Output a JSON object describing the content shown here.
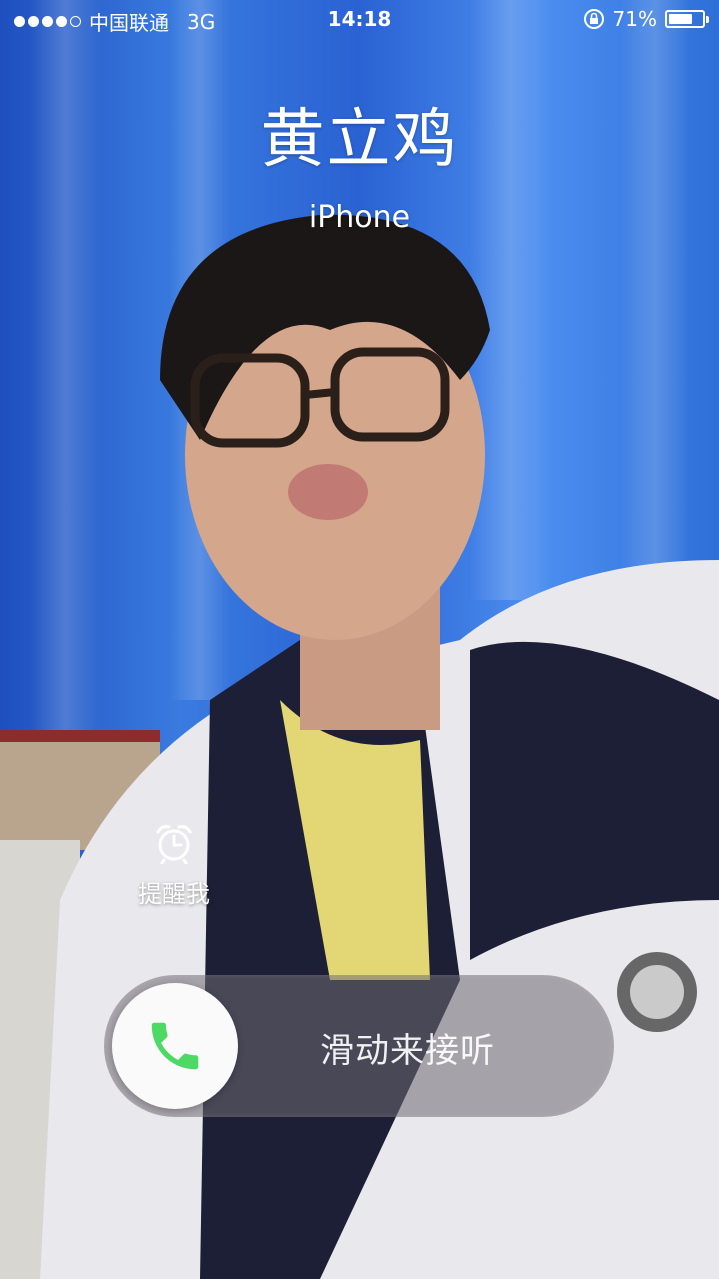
{
  "status_bar": {
    "carrier": "中国联通",
    "network": "3G",
    "time": "14:18",
    "battery": "71%",
    "battery_level": 0.71
  },
  "caller": {
    "name": "黄立鸡",
    "label": "iPhone"
  },
  "actions": {
    "remind_me": "提醒我"
  },
  "slider": {
    "label": "滑动来接听"
  },
  "colors": {
    "accept_green": "#4cd964",
    "background_blue": "#2b5fd0"
  }
}
